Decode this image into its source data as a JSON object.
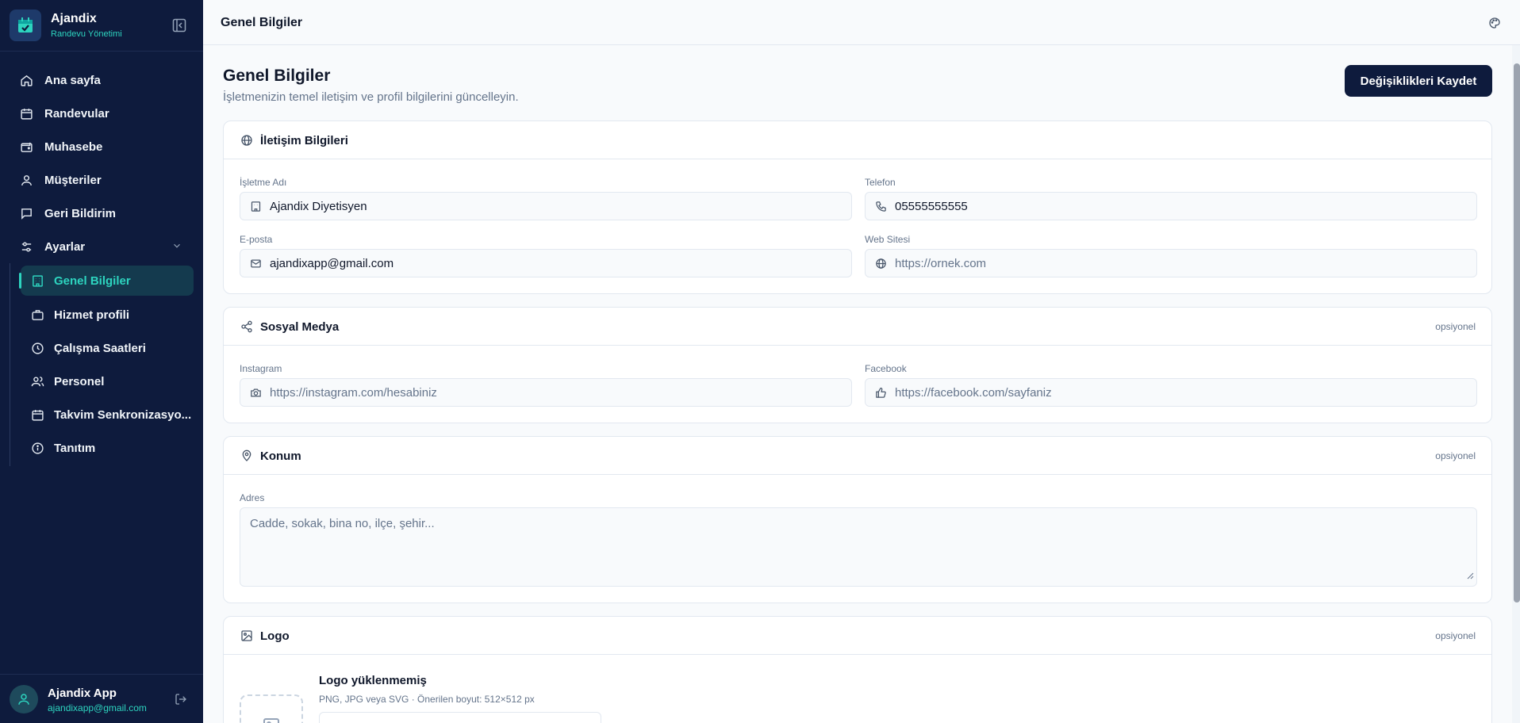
{
  "brand": {
    "name": "Ajandix",
    "subtitle": "Randevu Yönetimi"
  },
  "sidebar": {
    "items": [
      {
        "label": "Ana sayfa",
        "icon": "home-icon"
      },
      {
        "label": "Randevular",
        "icon": "calendar-icon"
      },
      {
        "label": "Muhasebe",
        "icon": "wallet-icon"
      },
      {
        "label": "Müşteriler",
        "icon": "user-icon"
      },
      {
        "label": "Geri Bildirim",
        "icon": "message-icon"
      },
      {
        "label": "Ayarlar",
        "icon": "settings-icon",
        "expanded": true
      }
    ],
    "sub_items": [
      {
        "label": "Genel Bilgiler",
        "icon": "building-icon",
        "active": true
      },
      {
        "label": "Hizmet profili",
        "icon": "briefcase-icon"
      },
      {
        "label": "Çalışma Saatleri",
        "icon": "clock-icon"
      },
      {
        "label": "Personel",
        "icon": "users-icon"
      },
      {
        "label": "Takvim Senkronizasyo...",
        "icon": "calendar-icon"
      },
      {
        "label": "Tanıtım",
        "icon": "info-icon"
      }
    ]
  },
  "user": {
    "name": "Ajandix App",
    "email": "ajandixapp@gmail.com"
  },
  "topbar": {
    "title": "Genel Bilgiler"
  },
  "page": {
    "title": "Genel Bilgiler",
    "subtitle": "İşletmenizin temel iletişim ve profil bilgilerini güncelleyin.",
    "save_label": "Değişiklikleri Kaydet"
  },
  "contact": {
    "title": "İletişim Bilgileri",
    "business_name": {
      "label": "İşletme Adı",
      "value": "Ajandix Diyetisyen"
    },
    "phone": {
      "label": "Telefon",
      "value": "05555555555"
    },
    "email": {
      "label": "E-posta",
      "value": "ajandixapp@gmail.com"
    },
    "website": {
      "label": "Web Sitesi",
      "placeholder": "https://ornek.com"
    }
  },
  "social": {
    "title": "Sosyal Medya",
    "optional": "opsiyonel",
    "instagram": {
      "label": "Instagram",
      "placeholder": "https://instagram.com/hesabiniz"
    },
    "facebook": {
      "label": "Facebook",
      "placeholder": "https://facebook.com/sayfaniz"
    }
  },
  "location": {
    "title": "Konum",
    "optional": "opsiyonel",
    "address": {
      "label": "Adres",
      "placeholder": "Cadde, sokak, bina no, ilçe, şehir..."
    }
  },
  "logo": {
    "title": "Logo",
    "optional": "opsiyonel",
    "status": "Logo yüklenmemiş",
    "hint": "PNG, JPG veya SVG · Önerilen boyut: 512×512 px"
  },
  "colors": {
    "sidebar_bg": "#0e1b3d",
    "accent": "#2dd4bf",
    "primary_button": "#0e1b3d"
  }
}
